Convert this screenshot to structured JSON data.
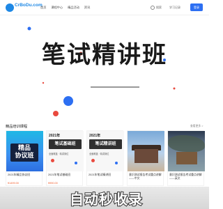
{
  "header": {
    "logo_text": "CrBoDu.com",
    "logo_sub": "",
    "nav": [
      "首页",
      "课程中心",
      "精品活动",
      "资讯"
    ],
    "search_label": "搜索",
    "study_label": "学习记录",
    "login_label": "登录"
  },
  "hero": {
    "title": "笔试精讲班"
  },
  "section": {
    "title": "精品培训课程",
    "more_label": "查看更多 >"
  },
  "cards": [
    {
      "thumb_text": "精品\n协议班",
      "name": "2021年精品协议班",
      "price": "¥1499.00"
    },
    {
      "year": "2021年",
      "badge": "笔试基础班",
      "sub": "全面覆盖 · 精讲到位",
      "name": "2021年笔试基础班",
      "price": "¥990.00"
    },
    {
      "year": "2021年",
      "badge": "笔试精讲班",
      "sub": "全面覆盖 · 精讲到位",
      "name": "2021年笔试精讲班",
      "price": ""
    },
    {
      "name": "意识测试报告考试重点讲解——中文",
      "price": ""
    },
    {
      "name": "意识测试报告考试重点讲解——英文",
      "price": ""
    }
  ],
  "watermark": "自动秒收录",
  "colors": {
    "brand": "#2d6ff2",
    "price": "#f25a29"
  }
}
